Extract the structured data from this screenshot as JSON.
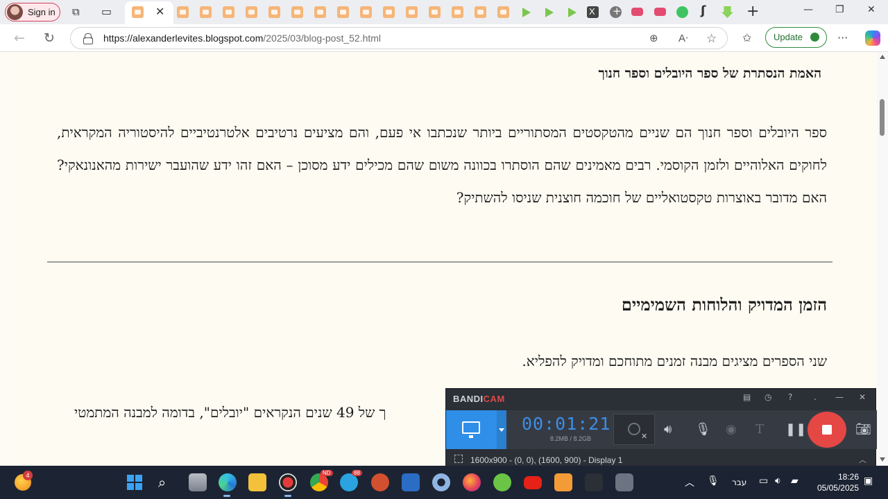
{
  "browser": {
    "signin_label": "Sign in",
    "tabs": [
      {
        "icon": "blogger-icon"
      },
      {
        "icon": "blogger-icon",
        "active": true
      },
      {
        "icon": "blogger-icon"
      },
      {
        "icon": "blogger-icon"
      },
      {
        "icon": "blogger-icon"
      },
      {
        "icon": "blogger-icon"
      },
      {
        "icon": "blogger-icon"
      },
      {
        "icon": "blogger-icon"
      },
      {
        "icon": "blogger-icon"
      },
      {
        "icon": "blogger-icon"
      },
      {
        "icon": "blogger-icon"
      },
      {
        "icon": "blogger-icon"
      },
      {
        "icon": "blogger-icon"
      },
      {
        "icon": "blogger-icon"
      },
      {
        "icon": "blogger-icon"
      },
      {
        "icon": "blogger-icon"
      },
      {
        "icon": "rumble-icon"
      },
      {
        "icon": "rumble-icon"
      },
      {
        "icon": "rumble-icon"
      },
      {
        "icon": "x-icon"
      },
      {
        "icon": "plus-icon"
      },
      {
        "icon": "youtube-icon"
      },
      {
        "icon": "youtube-icon"
      },
      {
        "icon": "spotify-icon"
      },
      {
        "icon": "feather-icon"
      },
      {
        "icon": "download-icon"
      }
    ],
    "url_host": "https://alexanderlevites.blogspot.com",
    "url_path": "/2025/03/blog-post_52.html",
    "update_label": "Update"
  },
  "article": {
    "section1_title": "האמת הנסתרת של ספר היובלים וספר חנוך",
    "section1_body": "ספר היובלים וספר חנוך הם שניים מהטקסטים המסתוריים ביותר שנכתבו אי פעם, והם מציעים נרטיבים אלטרנטיביים להיסטוריה המקראית, לחוקים האלוהיים ולזמן הקוסמי. רבים מאמינים שהם הוסתרו בכוונה משום שהם מכילים ידע מסוכן – האם זהו ידע שהועבר ישירות מהאנונאקי? האם מדובר באוצרות טקסטואליים של חוכמה חוצנית שניסו להשתיק?",
    "section2_title": "הזמן המדויק והלוחות השמימיים",
    "section2_p1": "שני הספרים מציגים מבנה זמנים מתוחכם ומדויק להפליא.",
    "section2_p2_right": "ך של 49 שנים הנקראים \"יובלים\", בדומה למבנה המתמטי"
  },
  "bandicam": {
    "brand_a": "BANDI",
    "brand_b": "CAM",
    "timer": "00:01:21",
    "file_size": "8.2MB / 8.2GB",
    "status": "1600x900 - (0, 0), (1600, 900) - Display 1"
  },
  "taskbar": {
    "weather_badge": "4",
    "chrome_badge": "ND",
    "telegram_badge": "88",
    "language": "עבר",
    "time": "18:26",
    "date": "05/05/2025"
  },
  "colors": {
    "page_bg": "#fdfbf2",
    "taskbar_bg": "#1c2433",
    "bandicam_accent": "#2f8ee8",
    "record_red": "#e54745"
  }
}
